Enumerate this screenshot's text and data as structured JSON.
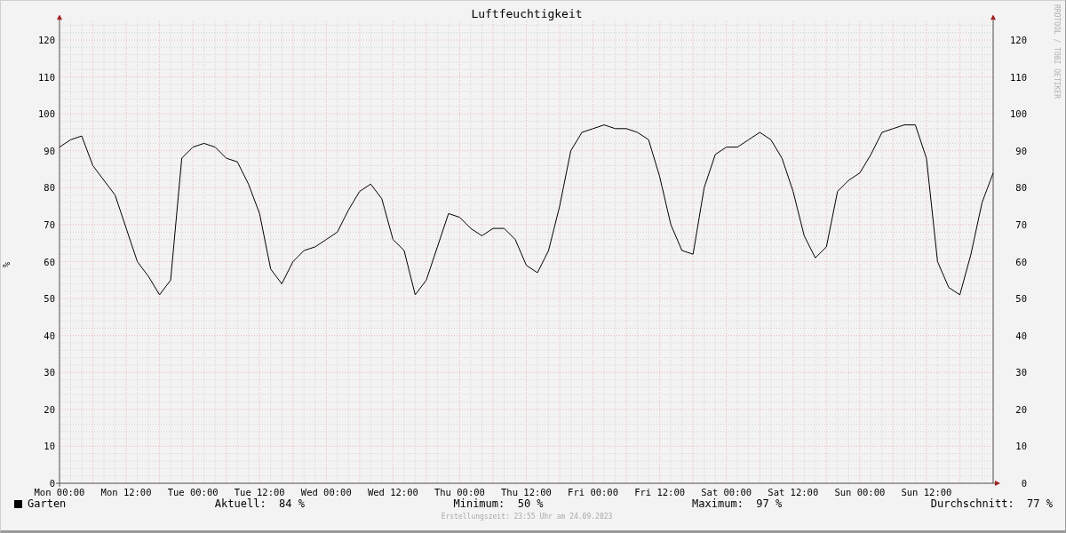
{
  "title": "Luftfeuchtigkeit",
  "side_credit": "RRDTOOL / TOBI OETIKER",
  "chart_data": {
    "type": "line",
    "grid": true,
    "ylabel": "%",
    "ylim": [
      0,
      125
    ],
    "categories": [
      "Mon 00:00",
      null,
      null,
      null,
      null,
      null,
      "Mon 12:00",
      null,
      null,
      null,
      null,
      null,
      "Tue 00:00",
      null,
      null,
      null,
      null,
      null,
      "Tue 12:00",
      null,
      null,
      null,
      null,
      null,
      "Wed 00:00",
      null,
      null,
      null,
      null,
      null,
      "Wed 12:00",
      null,
      null,
      null,
      null,
      null,
      "Thu 00:00",
      null,
      null,
      null,
      null,
      null,
      "Thu 12:00",
      null,
      null,
      null,
      null,
      null,
      "Fri 00:00",
      null,
      null,
      null,
      null,
      null,
      "Fri 12:00",
      null,
      null,
      null,
      null,
      null,
      "Sat 00:00",
      null,
      null,
      null,
      null,
      null,
      "Sat 12:00",
      null,
      null,
      null,
      null,
      null,
      "Sun 00:00",
      null,
      null,
      null,
      null,
      null,
      "Sun 12:00",
      null,
      null,
      null,
      null,
      null,
      null
    ],
    "series": [
      {
        "name": "Garten",
        "color": "#000000",
        "values": [
          91,
          93,
          94,
          86,
          82,
          78,
          69,
          60,
          56,
          51,
          55,
          88,
          91,
          92,
          91,
          88,
          87,
          81,
          73,
          58,
          54,
          60,
          63,
          64,
          66,
          68,
          74,
          79,
          81,
          77,
          66,
          63,
          51,
          55,
          64,
          73,
          72,
          69,
          67,
          69,
          69,
          66,
          59,
          57,
          63,
          75,
          90,
          95,
          96,
          97,
          96,
          96,
          95,
          93,
          83,
          70,
          63,
          62,
          80,
          89,
          91,
          91,
          93,
          95,
          93,
          88,
          79,
          67,
          61,
          64,
          79,
          82,
          84,
          89,
          95,
          96,
          97,
          97,
          88,
          60,
          53,
          51,
          62,
          76,
          84
        ]
      }
    ],
    "yticks": [
      0,
      10,
      20,
      30,
      40,
      50,
      60,
      70,
      80,
      90,
      100,
      110,
      120
    ]
  },
  "right_axis_labels": [
    "120",
    "110",
    "100",
    "90",
    "80",
    "70",
    "60",
    "50",
    "40",
    "30",
    "20",
    "10",
    "0"
  ],
  "stats": [
    {
      "label": "Aktuell:",
      "value": "84 %"
    },
    {
      "label": "Minimum:",
      "value": "50 %"
    },
    {
      "label": "Maximum:",
      "value": "97 %"
    },
    {
      "label": "Durchschnitt:",
      "value": "77 %"
    }
  ],
  "footer": "Erstellungszeit: 23:55 Uhr am 24.09.2023"
}
